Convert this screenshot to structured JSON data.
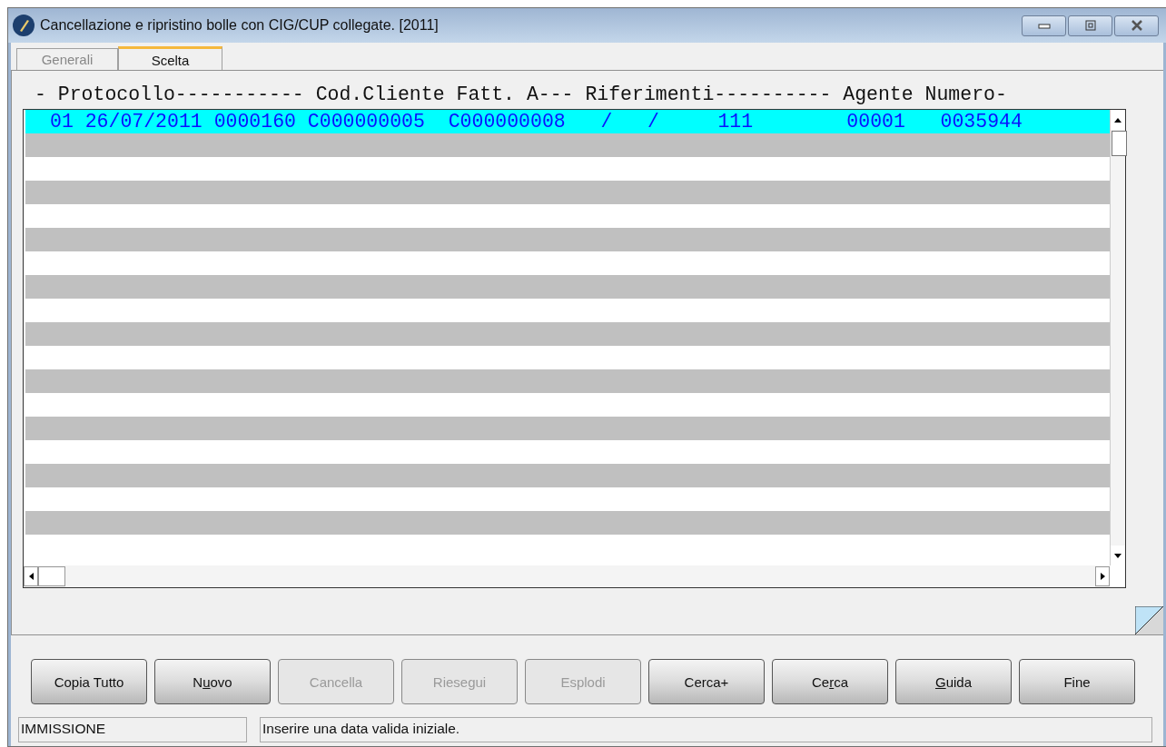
{
  "window": {
    "title": "Cancellazione e ripristino bolle con CIG/CUP collegate. [2011]"
  },
  "tabs": [
    {
      "label": "Generali",
      "selected": false
    },
    {
      "label": "Scelta",
      "selected": true
    }
  ],
  "list": {
    "header": "- Protocollo----------- Cod.Cliente Fatt. A--- Riferimenti---------- Agente Numero-",
    "rows": [
      {
        "text": "01 26/07/2011 0000160 C000000005  C000000008   /   /     111        00001   0035944",
        "selected": true
      }
    ]
  },
  "buttons": [
    {
      "pre": "Copia Tutto",
      "disabled": false
    },
    {
      "pre": "N",
      "key": "u",
      "post": "ovo",
      "disabled": false
    },
    {
      "pre": "Cancella",
      "disabled": true
    },
    {
      "pre": "Riesegui",
      "disabled": true
    },
    {
      "pre": "Esplodi",
      "disabled": true
    },
    {
      "pre": "Cerca+",
      "disabled": false
    },
    {
      "pre": "Ce",
      "key": "r",
      "post": "ca",
      "disabled": false
    },
    {
      "key": "G",
      "post": "uida",
      "disabled": false
    },
    {
      "pre": "Fine",
      "disabled": false
    }
  ],
  "status_bar": {
    "mode": "IMMISSIONE",
    "message": "Inserire una data valida iniziale."
  }
}
